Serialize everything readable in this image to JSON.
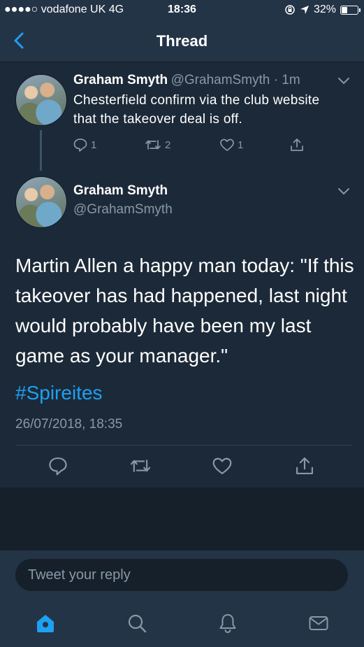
{
  "status": {
    "carrier": "●●●●○ vodafone UK   4G",
    "time": "18:36",
    "battery": "32%",
    "battery_level": 0.32
  },
  "nav": {
    "title": "Thread"
  },
  "tweet1": {
    "name": "Graham Smyth",
    "handle_time": "@GrahamSmyth · 1m",
    "text": "Chesterfield confirm via the club website that the takeover deal is off.",
    "replies": "1",
    "retweets": "2",
    "likes": "1"
  },
  "tweet2": {
    "name": "Graham Smyth",
    "handle": "@GrahamSmyth",
    "text": "Martin Allen a happy man today: \"If this takeover has had happened, last night would probably have been my last game as your manager.\"",
    "hashtag": "#Spireites",
    "timestamp": "26/07/2018, 18:35"
  },
  "reply": {
    "placeholder": "Tweet your reply"
  },
  "colors": {
    "accent": "#1da1f2",
    "background": "#1c2938",
    "bar": "#243447",
    "muted": "#8899a6"
  }
}
